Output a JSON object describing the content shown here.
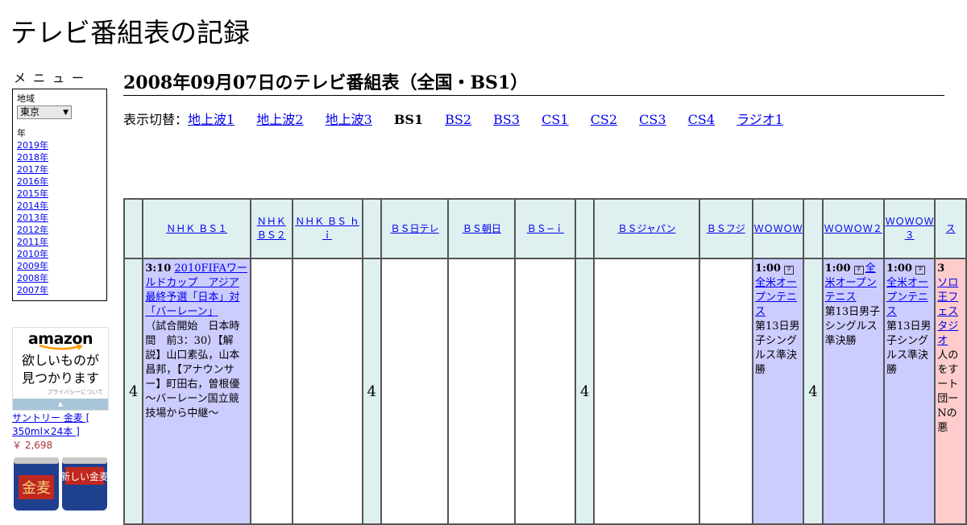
{
  "site_title": "テレビ番組表の記録",
  "menu": {
    "label": "メニュー",
    "region_label": "地域",
    "region_value": "東京",
    "year_label": "年",
    "years": [
      "2019年",
      "2018年",
      "2017年",
      "2016年",
      "2015年",
      "2014年",
      "2013年",
      "2012年",
      "2011年",
      "2010年",
      "2009年",
      "2008年",
      "2007年"
    ]
  },
  "ad": {
    "logo": "amazon",
    "text_line1": "欲しいものが",
    "text_line2": "見つかります",
    "privacy": "プライバシーについて",
    "product_line1": "サントリー 金麦 [",
    "product_line2": "350ml×24本 ]",
    "product_price": "￥ 2,698"
  },
  "page_heading": "2008年09月07日のテレビ番組表（全国・BS1）",
  "switcher": {
    "label": "表示切替：",
    "items": [
      {
        "label": "地上波1",
        "current": false
      },
      {
        "label": "地上波2",
        "current": false
      },
      {
        "label": "地上波3",
        "current": false
      },
      {
        "label": "BS1",
        "current": true
      },
      {
        "label": "BS2",
        "current": false
      },
      {
        "label": "BS3",
        "current": false
      },
      {
        "label": "CS1",
        "current": false
      },
      {
        "label": "CS2",
        "current": false
      },
      {
        "label": "CS3",
        "current": false
      },
      {
        "label": "CS4",
        "current": false
      },
      {
        "label": "ラジオ1",
        "current": false
      }
    ]
  },
  "channels": {
    "nhkbs1": "ＮＨＫ ＢＳ１",
    "nhkbs2": "ＮＨＫ ＢＳ２",
    "nhkbshi": "ＮＨＫ ＢＳ ｈｉ",
    "bsntv": "ＢＳ日テレ",
    "bsasahi": "ＢＳ朝日",
    "bsi": "ＢＳ−ｉ",
    "bsjapan": "ＢＳジャパン",
    "bsfuji": "ＢＳフジ",
    "wowow": "ＷＯＷＯＷ",
    "wowow2": "ＷＯＷＯＷ２",
    "wowow3": "ＷＯＷＯＷ３",
    "star": "ス"
  },
  "hour": "4",
  "programs": {
    "nhkbs1": {
      "time": "3:10",
      "title": "2010FIFAワールドカップ　アジア最終予選「日本」対「バーレーン」",
      "desc": "（試合開始　日本時間　前3：30）【解説】山口素弘，山本昌邦，【アナウンサー】町田右，曽根優　～バーレーン国立競技場から中継～"
    },
    "wowow": {
      "time": "1:00",
      "title": "全米オープンテニス",
      "desc": "第13日男子シングルス準決勝"
    },
    "wowow2": {
      "time": "1:00",
      "title": "全米オープンテニス",
      "desc": "第13日男子シングルス準決勝"
    },
    "wowow3": {
      "time": "1:00",
      "title": "全米オープンテニス",
      "desc": "第13日男子シングルス準決勝"
    },
    "star": {
      "time": "3",
      "title": "ソロ王フェスタジオ",
      "desc": "人のをすート団ーNの悪"
    }
  },
  "colors": {
    "program_bg": "#ccccff",
    "header_bg": "#dff0f0",
    "pink_bg": "#ffcccc",
    "link": "#0000ee"
  }
}
